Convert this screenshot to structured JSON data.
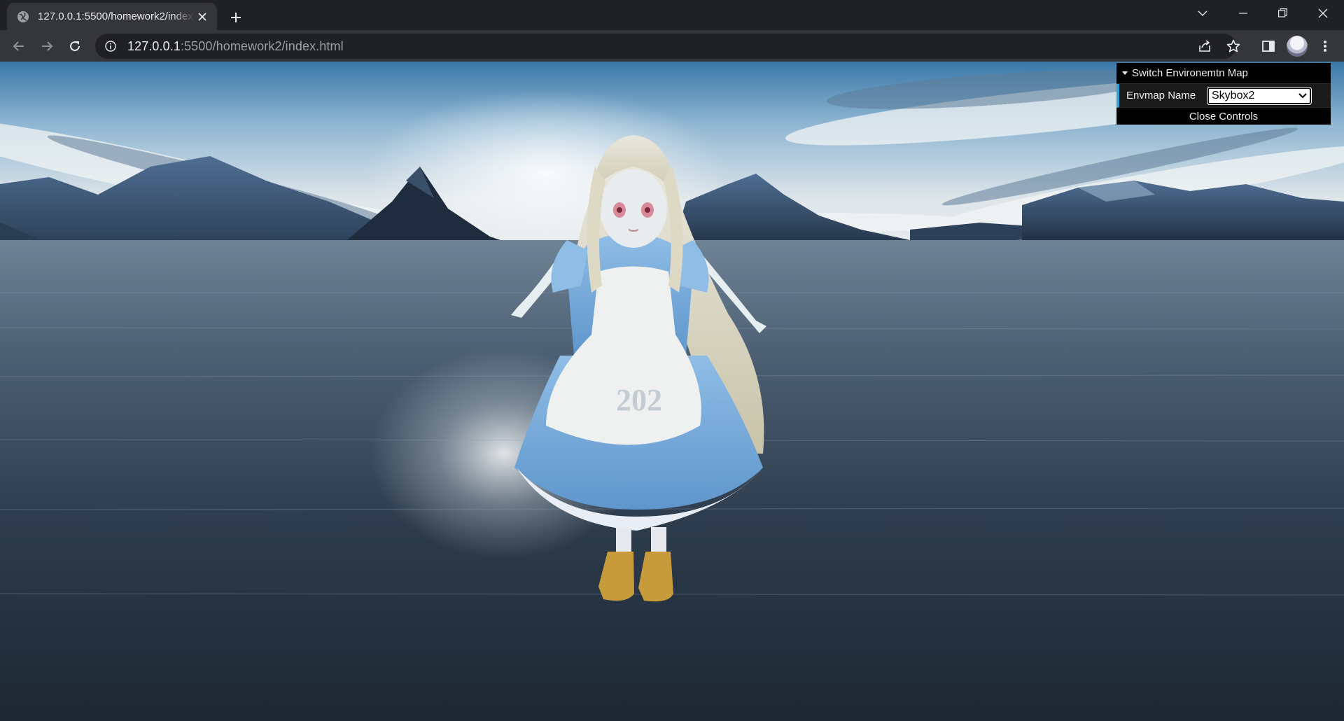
{
  "browser": {
    "tab": {
      "title": "127.0.0.1:5500/homework2/index.html"
    },
    "url": {
      "host": "127.0.0.1",
      "rest": ":5500/homework2/index.html"
    }
  },
  "gui": {
    "folder_title": "Switch Environemtn Map",
    "envmap_label": "Envmap Name",
    "envmap_value": "Skybox2",
    "close_label": "Close Controls"
  },
  "scene": {
    "apron_text": "202"
  },
  "colors": {
    "tab_strip": "#202124",
    "toolbar": "#35363a",
    "gui_accent": "#2fa1d6"
  }
}
